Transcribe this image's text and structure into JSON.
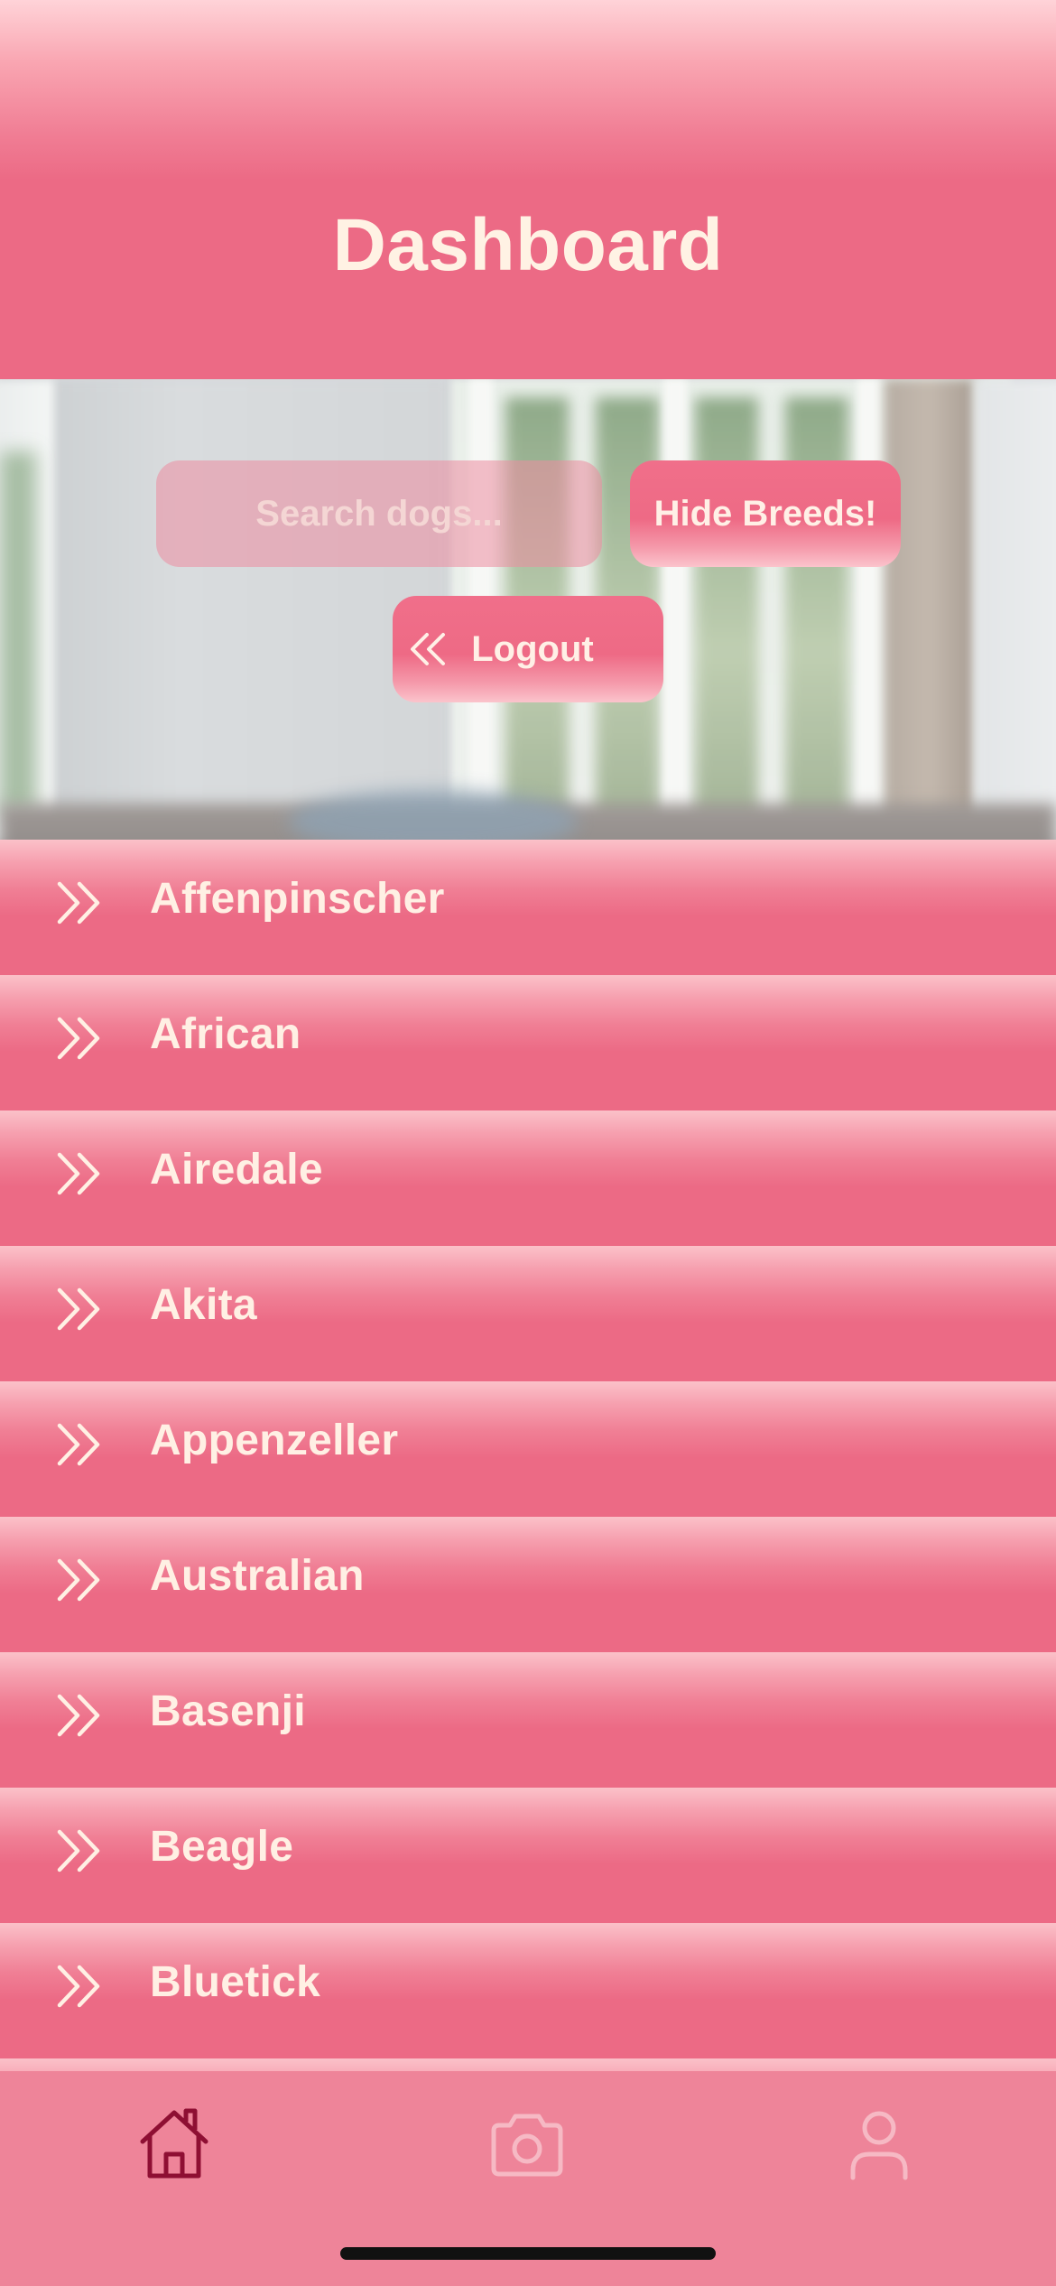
{
  "header": {
    "title": "Dashboard"
  },
  "controls": {
    "search_placeholder": "Search dogs...",
    "hide_breeds_label": "Hide Breeds!",
    "logout_label": "Logout",
    "logout_icon": "chevrons-left-icon"
  },
  "breeds": [
    {
      "label": "Affenpinscher",
      "icon": "chevrons-right-icon"
    },
    {
      "label": "African",
      "icon": "chevrons-right-icon"
    },
    {
      "label": "Airedale",
      "icon": "chevrons-right-icon"
    },
    {
      "label": "Akita",
      "icon": "chevrons-right-icon"
    },
    {
      "label": "Appenzeller",
      "icon": "chevrons-right-icon"
    },
    {
      "label": "Australian",
      "icon": "chevrons-right-icon"
    },
    {
      "label": "Basenji",
      "icon": "chevrons-right-icon"
    },
    {
      "label": "Beagle",
      "icon": "chevrons-right-icon"
    },
    {
      "label": "Bluetick",
      "icon": "chevrons-right-icon"
    }
  ],
  "tabbar": {
    "tabs": [
      {
        "name": "home",
        "icon": "home-icon",
        "active": true
      },
      {
        "name": "camera",
        "icon": "camera-icon",
        "active": false
      },
      {
        "name": "profile",
        "icon": "user-icon",
        "active": false
      }
    ]
  },
  "colors": {
    "primary": "#ec6a85",
    "highlight": "#fbc1c9",
    "text_light": "#fff0e4",
    "tab_active": "#8e0f33",
    "tab_inactive": "#f6b9c4",
    "tabbar_bg": "#ee8499"
  }
}
